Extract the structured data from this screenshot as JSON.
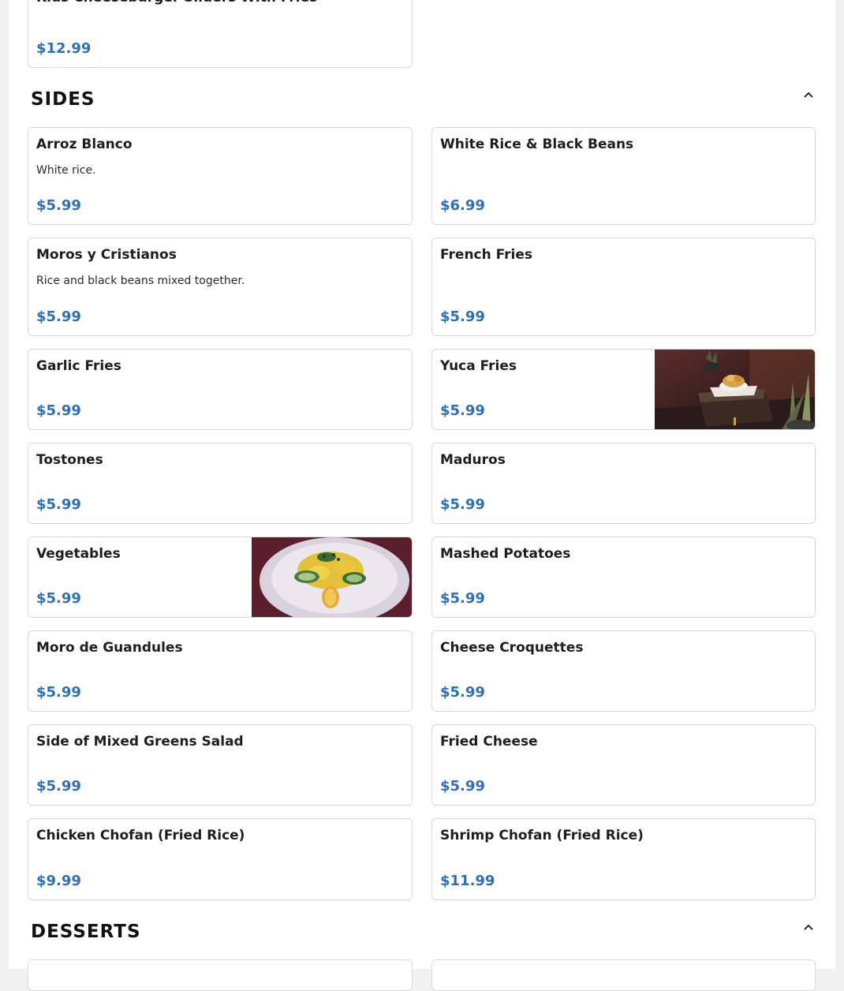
{
  "prev_item": {
    "name": "Kids Cheeseburger Sliders With Fries",
    "price": "$12.99"
  },
  "sides": {
    "title": "SIDES",
    "items": [
      {
        "name": "Arroz Blanco",
        "desc": "White rice.",
        "price": "$5.99"
      },
      {
        "name": "White Rice & Black Beans",
        "price": "$6.99"
      },
      {
        "name": "Moros y Cristianos",
        "desc": "Rice and black beans mixed together.",
        "price": "$5.99"
      },
      {
        "name": "French Fries",
        "price": "$5.99"
      },
      {
        "name": "Garlic Fries",
        "price": "$5.99"
      },
      {
        "name": "Yuca Fries",
        "price": "$5.99"
      },
      {
        "name": "Tostones",
        "price": "$5.99"
      },
      {
        "name": "Maduros",
        "price": "$5.99"
      },
      {
        "name": "Vegetables",
        "price": "$5.99"
      },
      {
        "name": "Mashed Potatoes",
        "price": "$5.99"
      },
      {
        "name": "Moro de Guandules",
        "price": "$5.99"
      },
      {
        "name": "Cheese Croquettes",
        "price": "$5.99"
      },
      {
        "name": "Side of Mixed Greens Salad",
        "price": "$5.99"
      },
      {
        "name": "Fried Cheese",
        "price": "$5.99"
      },
      {
        "name": "Chicken Chofan (Fried Rice)",
        "price": "$9.99"
      },
      {
        "name": "Shrimp Chofan (Fried Rice)",
        "price": "$11.99"
      }
    ]
  },
  "desserts": {
    "title": "DESSERTS"
  },
  "icons": {
    "collapse": "chevron-up-icon"
  },
  "colors": {
    "price": "#2f6fb2",
    "border": "#d9d9d9"
  }
}
